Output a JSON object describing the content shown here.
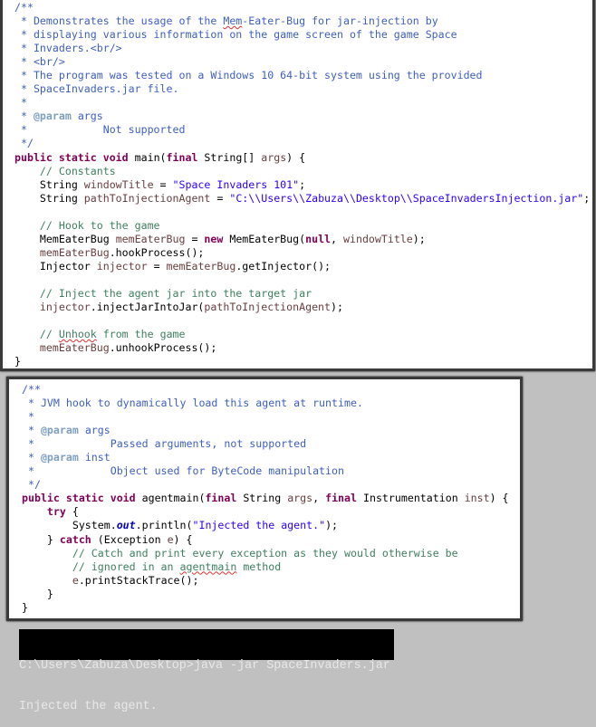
{
  "top_code": {
    "lines": [
      [
        [
          "c",
          "/**"
        ]
      ],
      [
        [
          "c",
          " * Demonstrates the usage of the "
        ],
        [
          "w",
          "Mem"
        ],
        [
          "c",
          "-Eater-Bug for jar-injection by"
        ]
      ],
      [
        [
          "c",
          " * displaying various information on the game screen of the game Space"
        ]
      ],
      [
        [
          "c",
          " * Invaders.<br/>"
        ]
      ],
      [
        [
          "c",
          " * <br/>"
        ]
      ],
      [
        [
          "c",
          " * The program was tested on a Windows 10 64-bit system using the provided"
        ]
      ],
      [
        [
          "c",
          " * SpaceInvaders.jar file."
        ]
      ],
      [
        [
          "c",
          " *"
        ]
      ],
      [
        [
          "c",
          " * "
        ],
        [
          "t",
          "@param"
        ],
        [
          "c",
          " args"
        ]
      ],
      [
        [
          "c",
          " *            Not supported"
        ]
      ],
      [
        [
          "c",
          " */"
        ]
      ],
      [
        [
          "k",
          "public static void "
        ],
        [
          "p",
          "main("
        ],
        [
          "k",
          "final "
        ],
        [
          "p",
          "String[] "
        ],
        [
          "v",
          "args"
        ],
        [
          "p",
          ") {"
        ]
      ],
      [
        [
          "l",
          "    // Constants"
        ]
      ],
      [
        [
          "p",
          "    String "
        ],
        [
          "v",
          "windowTitle"
        ],
        [
          "p",
          " = "
        ],
        [
          "s",
          "\"Space Invaders 101\""
        ],
        [
          "p",
          ";"
        ]
      ],
      [
        [
          "p",
          "    String "
        ],
        [
          "v",
          "pathToInjectionAgent"
        ],
        [
          "p",
          " = "
        ],
        [
          "s",
          "\"C:\\\\Users\\\\Zabuza\\\\Desktop\\\\SpaceInvadersInjection.jar\""
        ],
        [
          "p",
          ";"
        ]
      ],
      [
        [
          "p",
          ""
        ]
      ],
      [
        [
          "l",
          "    // Hook to the game"
        ]
      ],
      [
        [
          "p",
          "    MemEaterBug "
        ],
        [
          "v",
          "memEaterBug"
        ],
        [
          "p",
          " = "
        ],
        [
          "k",
          "new "
        ],
        [
          "p",
          "MemEaterBug("
        ],
        [
          "k",
          "null"
        ],
        [
          "p",
          ", "
        ],
        [
          "v",
          "windowTitle"
        ],
        [
          "p",
          ");"
        ]
      ],
      [
        [
          "v",
          "    memEaterBug"
        ],
        [
          "p",
          ".hookProcess();"
        ]
      ],
      [
        [
          "p",
          "    Injector "
        ],
        [
          "v",
          "injector"
        ],
        [
          "p",
          " = "
        ],
        [
          "v",
          "memEaterBug"
        ],
        [
          "p",
          ".getInjector();"
        ]
      ],
      [
        [
          "p",
          ""
        ]
      ],
      [
        [
          "l",
          "    // Inject the agent jar into the target jar"
        ]
      ],
      [
        [
          "v",
          "    injector"
        ],
        [
          "p",
          ".injectJarIntoJar("
        ],
        [
          "v",
          "pathToInjectionAgent"
        ],
        [
          "p",
          ");"
        ]
      ],
      [
        [
          "p",
          ""
        ]
      ],
      [
        [
          "l",
          "    // "
        ],
        [
          "lw",
          "Unhook"
        ],
        [
          "l",
          " from the game"
        ]
      ],
      [
        [
          "v",
          "    memEaterBug"
        ],
        [
          "p",
          ".unhookProcess();"
        ]
      ],
      [
        [
          "p",
          "}"
        ]
      ]
    ]
  },
  "bottom_code": {
    "lines": [
      [
        [
          "c",
          "/**"
        ]
      ],
      [
        [
          "c",
          " * JVM hook to dynamically load this agent at runtime."
        ]
      ],
      [
        [
          "c",
          " *"
        ]
      ],
      [
        [
          "c",
          " * "
        ],
        [
          "t",
          "@param"
        ],
        [
          "c",
          " args"
        ]
      ],
      [
        [
          "c",
          " *            Passed arguments, not supported"
        ]
      ],
      [
        [
          "c",
          " * "
        ],
        [
          "t",
          "@param"
        ],
        [
          "c",
          " inst"
        ]
      ],
      [
        [
          "c",
          " *            Object used for ByteCode manipulation"
        ]
      ],
      [
        [
          "c",
          " */"
        ]
      ],
      [
        [
          "k",
          "public static void "
        ],
        [
          "p",
          "agentmain("
        ],
        [
          "k",
          "final "
        ],
        [
          "p",
          "String "
        ],
        [
          "v",
          "args"
        ],
        [
          "p",
          ", "
        ],
        [
          "k",
          "final "
        ],
        [
          "p",
          "Instrumentation "
        ],
        [
          "v",
          "inst"
        ],
        [
          "p",
          ") {"
        ]
      ],
      [
        [
          "k",
          "    try "
        ],
        [
          "p",
          "{"
        ]
      ],
      [
        [
          "p",
          "        System."
        ],
        [
          "f",
          "out"
        ],
        [
          "p",
          ".println("
        ],
        [
          "s",
          "\"Injected the agent.\""
        ],
        [
          "p",
          ");"
        ]
      ],
      [
        [
          "p",
          "    } "
        ],
        [
          "k",
          "catch "
        ],
        [
          "p",
          "(Exception "
        ],
        [
          "v",
          "e"
        ],
        [
          "p",
          ") {"
        ]
      ],
      [
        [
          "l",
          "        // Catch and print every exception as they would otherwise be"
        ]
      ],
      [
        [
          "l",
          "        // ignored in an "
        ],
        [
          "lw",
          "agentmain"
        ],
        [
          "l",
          " method"
        ]
      ],
      [
        [
          "v",
          "        e"
        ],
        [
          "p",
          ".printStackTrace();"
        ]
      ],
      [
        [
          "p",
          "    }"
        ]
      ],
      [
        [
          "p",
          "}"
        ]
      ]
    ]
  },
  "terminal": {
    "lines": [
      "C:\\Users\\Zabuza\\Desktop>java -jar SpaceInvaders.jar",
      "Injected the agent."
    ]
  }
}
